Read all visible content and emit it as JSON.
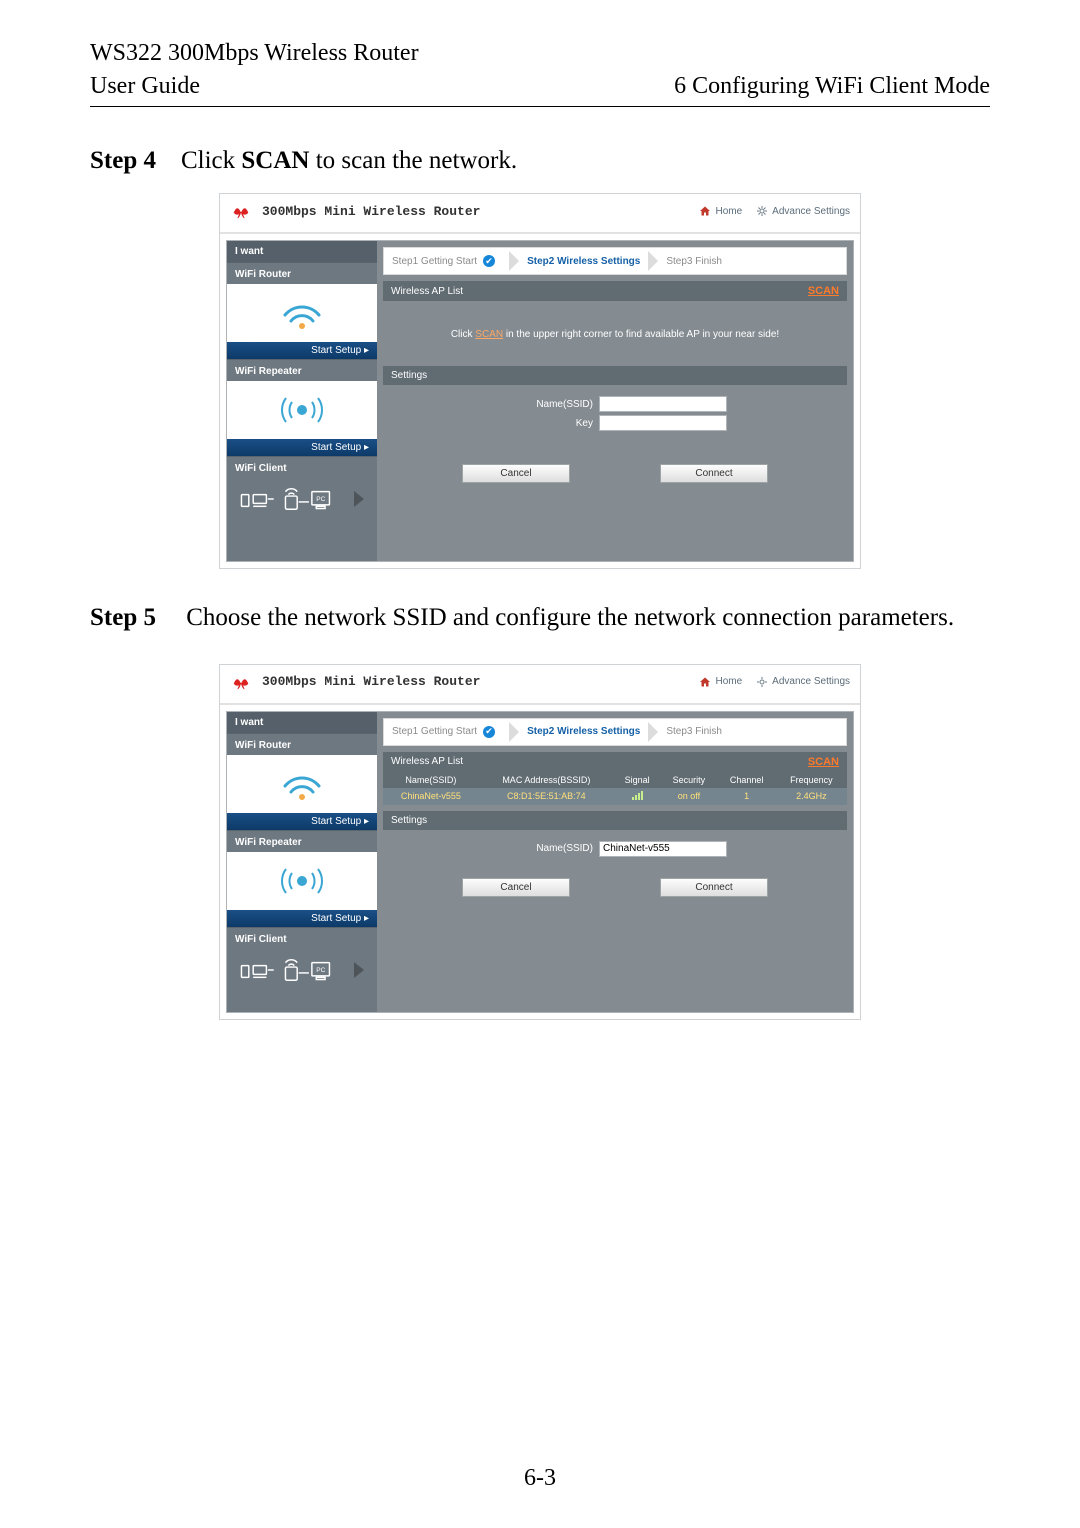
{
  "doc": {
    "product": "WS322 300Mbps Wireless Router",
    "guide": "User Guide",
    "chapter": "6 Configuring WiFi Client Mode",
    "page_number": "6-3"
  },
  "steps": {
    "s4_label": "Step 4",
    "s4_text_a": "Click ",
    "s4_text_bold": "SCAN",
    "s4_text_b": " to scan the network.",
    "s5_label": "Step 5",
    "s5_text": "Choose the network SSID and configure the network connection parameters."
  },
  "router": {
    "title": "300Mbps Mini Wireless Router",
    "home": "Home",
    "advance": "Advance Settings",
    "sidebar": {
      "iwant": "I want",
      "wifi_router": "WiFi Router",
      "wifi_repeater": "WiFi Repeater",
      "wifi_client": "WiFi Client",
      "start_setup": "Start Setup ▸"
    },
    "breadcrumb": {
      "step1": "Step1 Getting Start",
      "step2": "Step2 Wireless Settings",
      "step3": "Step3 Finish"
    },
    "panel": {
      "ap_list": "Wireless AP List",
      "scan": "SCAN",
      "hint_a": "Click ",
      "hint_link": "SCAN",
      "hint_b": " in the upper right corner to find available AP in your near side!",
      "settings": "Settings",
      "name_ssid": "Name(SSID)",
      "key": "Key",
      "cancel": "Cancel",
      "connect": "Connect"
    },
    "ap_columns": {
      "name": "Name(SSID)",
      "mac": "MAC Address(BSSID)",
      "signal": "Signal",
      "security": "Security",
      "channel": "Channel",
      "freq": "Frequency"
    },
    "ap_row": {
      "name": "ChinaNet-v555",
      "mac": "C8:D1:5E:51:AB:74",
      "security": "on off",
      "channel": "1",
      "freq": "2.4GHz"
    },
    "form2_ssid_value": "ChinaNet-v555"
  }
}
